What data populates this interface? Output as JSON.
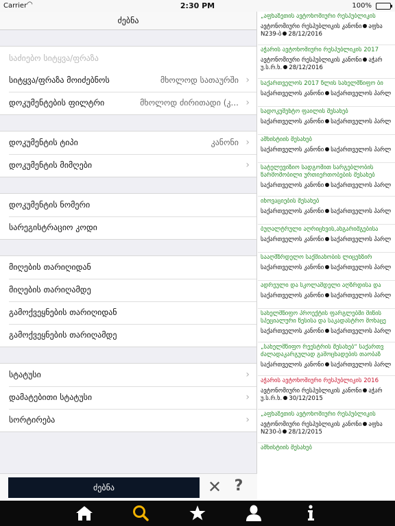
{
  "status_bar": {
    "carrier": "Carrier",
    "time": "2:30 PM",
    "battery": "100%",
    "battery_level": 1.0
  },
  "left_panel": {
    "title": "ძებნა",
    "search_input": {
      "value": "",
      "placeholder": "საძიებო სიტყვა/ფრაზა"
    },
    "rows": {
      "word_search": {
        "label": "სიტყვა/ფრაზა მოიძებნოს",
        "value": "მხოლოდ სათაურში"
      },
      "doc_filter": {
        "label": "დოკუმენტების ფილტრი",
        "value": "მხოლოდ ძირითადი (კ..."
      },
      "doc_type": {
        "label": "დოკუმენტის ტიპი",
        "value": "კანონი"
      },
      "doc_issuer": {
        "label": "დოკუმენტის მიმღები"
      },
      "doc_number": {
        "label": "დოკუმენტის ნომერი"
      },
      "reg_code": {
        "label": "სარეგისტრაციო კოდი"
      },
      "accept_from": {
        "label": "მიღების თარიღიდან"
      },
      "accept_to": {
        "label": "მიღების თარიღამდე"
      },
      "publish_from": {
        "label": "გამოქვეყნების თარიღიდან"
      },
      "publish_to": {
        "label": "გამოქვეყნების თარიღამდე"
      },
      "status": {
        "label": "სტატუსი"
      },
      "extra_status": {
        "label": "დამატებითი სტატუსი"
      },
      "sorting": {
        "label": "სორტირება"
      }
    },
    "search_button": "ძებნა",
    "clear_icon": "✕",
    "help_icon": "?"
  },
  "results": [
    {
      "title": "„აფხაზეთის ავტონომიური რესპუბლიკის",
      "type": "ავტონომიური რესპუბლიკის კანონი",
      "issuer": "აფხა",
      "extra": "N239-ბ",
      "date": "28/12/2016",
      "color": "green"
    },
    {
      "title": "აჭარის ავტონომიური რესპუბლიკის 2017",
      "type": "ავტონომიური რესპუბლიკის კანონი",
      "issuer": "აჭარ",
      "extra": "უ.ს.რ.ხ.",
      "date": "28/12/2016",
      "color": "green"
    },
    {
      "title": "საქართველოს 2017 წლის სახელმწიფო ბი",
      "type": "საქართველოს კანონი",
      "issuer": "საქართველოს პარლ",
      "color": "green"
    },
    {
      "title": "სადოკუმენტო ფაილის შესახებ",
      "type": "საქართველოს კანონი",
      "issuer": "საქართველოს პარლ",
      "color": "green"
    },
    {
      "title": "ამნისტიის შესახებ",
      "type": "საქართველოს კანონი",
      "issuer": "საქართველოს პარლ",
      "color": "green"
    },
    {
      "title": "სატელევიზიო სადგომით სარგებლობის",
      "title2": "წარმოშობილი ურთიერთობების შესახებ",
      "type": "საქართველოს კანონი",
      "issuer": "საქართველოს პარლ",
      "color": "green"
    },
    {
      "title": "ინოვაციების შესახებ",
      "type": "საქართველოს კანონი",
      "issuer": "საქართველოს პარლ",
      "color": "green"
    },
    {
      "title": "ბუღალტრული აღრიცხვის,ანგარიშგებისა",
      "type": "საქართველოს კანონი",
      "issuer": "საქართველოს პარლ",
      "color": "green"
    },
    {
      "title": "სააღმზრდელო საქმიანობის ლიცენზირ",
      "type": "საქართველოს კანონი",
      "issuer": "საქართველოს პარლ",
      "color": "green"
    },
    {
      "title": "ადრეული და სკოლამდელი აღზრდისა და",
      "type": "საქართველოს კანონი",
      "issuer": "საქართველოს პარლ",
      "color": "green"
    },
    {
      "title": "სახელმწიფო პროექტის ფარგლებში მიწის",
      "title2": "სპეციალური წესისა და საკადასტრო მონაცე",
      "type": "საქართველოს კანონი",
      "issuer": "საქართველოს პარლ",
      "color": "green"
    },
    {
      "title": "„სახელმწიფო რეესტრის შესახებ“ საქართვ",
      "title2": "ძალადაკარგულად გამოცხადების თაობაზ",
      "type": "საქართველოს კანონი",
      "issuer": "საქართველოს პარლ",
      "color": "green"
    },
    {
      "title": "აჭარის ავტონომიური რესპუბლიკის 2016",
      "type": "ავტონომიური რესპუბლიკის კანონი",
      "issuer": "აჭარ",
      "extra": "უ.ს.რ.ხ.",
      "date": "30/12/2015",
      "color": "red"
    },
    {
      "title": "„აფხაზეთის ავტონომიური რესპუბლიკის",
      "type": "ავტონომიური რესპუბლიკის კანონი",
      "issuer": "აფხა",
      "extra": "N230-ბ",
      "date": "28/12/2015",
      "color": "green"
    },
    {
      "title": "ამნისტიის შესახებ",
      "color": "green"
    }
  ],
  "tabbar": {
    "icons": [
      "home-icon",
      "search-icon",
      "star-icon",
      "person-icon",
      "info-icon"
    ],
    "active": "search-icon",
    "active_color": "#f2b200"
  }
}
